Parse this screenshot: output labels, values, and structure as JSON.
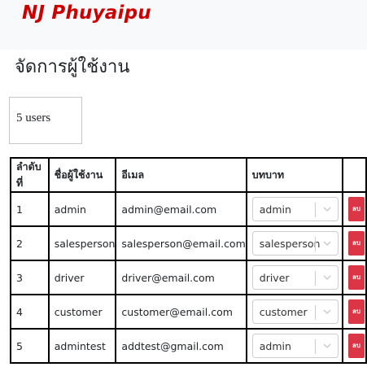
{
  "navbar": {
    "brand": "NJ Phuyaipu"
  },
  "page": {
    "title": "จัดการผู้ใช้งาน",
    "user_count": "5 users"
  },
  "table": {
    "headers": {
      "index": "ลำดับที่",
      "username": "ชื่อผู้ใช้งาน",
      "email": "อีเมล",
      "role": "บทบาท",
      "action": ""
    },
    "rows": [
      {
        "index": "1",
        "username": "admin",
        "email": "admin@email.com",
        "role": "admin",
        "delete_label": "ลบ"
      },
      {
        "index": "2",
        "username": "salesperson",
        "email": "salesperson@email.com",
        "role": "salesperson",
        "delete_label": "ลบ"
      },
      {
        "index": "3",
        "username": "driver",
        "email": "driver@email.com",
        "role": "driver",
        "delete_label": "ลบ"
      },
      {
        "index": "4",
        "username": "customer",
        "email": "customer@email.com",
        "role": "customer",
        "delete_label": "ลบ"
      },
      {
        "index": "5",
        "username": "admintest",
        "email": "addtest@gmail.com",
        "role": "admin",
        "delete_label": "ลบ"
      }
    ]
  },
  "colors": {
    "brand": "#cc0000",
    "navbar_bg": "#f8f9fa",
    "delete_button": "#dc3545"
  },
  "icons": {
    "select_arrow": "chevron-down-icon"
  }
}
